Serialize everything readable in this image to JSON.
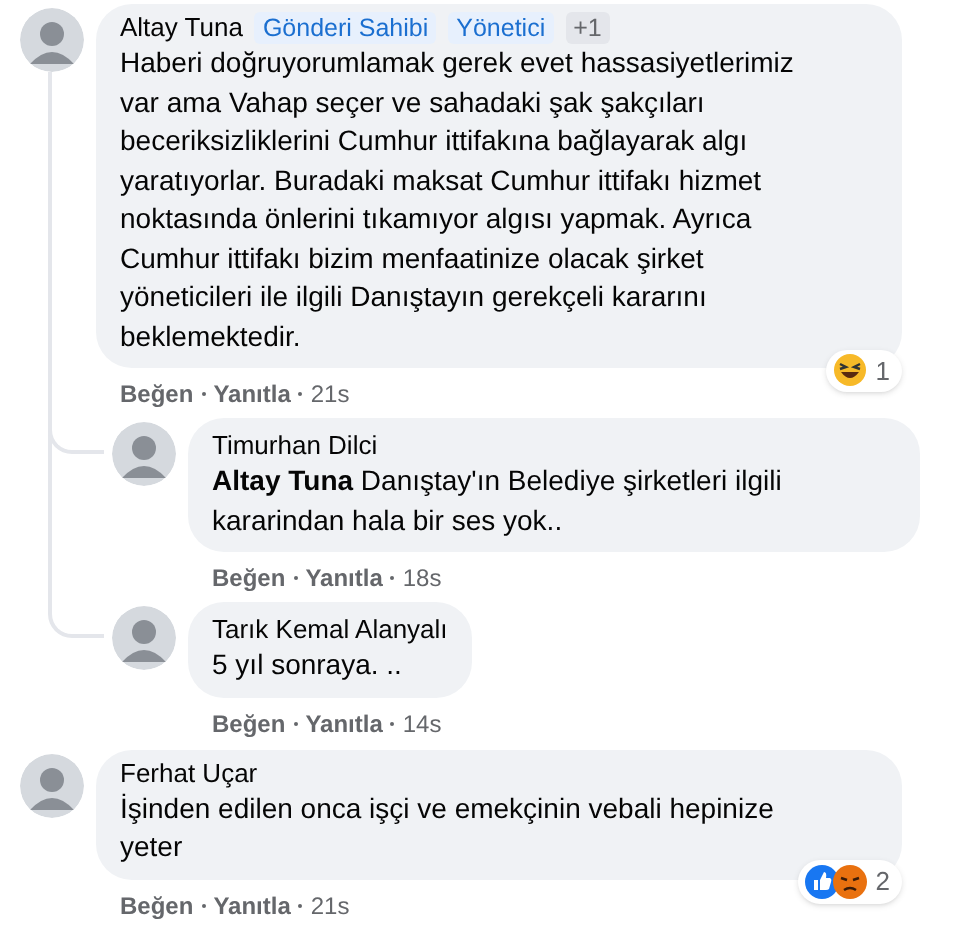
{
  "comments": [
    {
      "author": "Altay Tuna",
      "badges": [
        "Gönderi Sahibi",
        "Yönetici",
        "+1"
      ],
      "text": "Haberi doğruyorumlamak gerek evet hassasiyetlerimiz var ama Vahap seçer ve sahadaki şak şakçıları beceriksizliklerini Cumhur ittifakına bağlayarak algı yaratıyorlar. Buradaki maksat Cumhur ittifakı hizmet noktasında önlerini tıkamıyor algısı yapmak. Ayrıca Cumhur ittifakı bizim menfaatinize olacak şirket yöneticileri ile ilgili Danıştayın gerekçeli kararını beklemektedir.",
      "reactions": [
        {
          "kind": "haha"
        }
      ],
      "reaction_count": "1",
      "actions": [
        "Beğen",
        "Yanıtla",
        "21s"
      ],
      "replies": [
        {
          "author": "Timurhan Dilci",
          "mention": "Altay Tuna",
          "text": "Danıştay'ın Belediye şirketleri ilgili kararindan hala bir ses yok..",
          "actions": [
            "Beğen",
            "Yanıtla",
            "18s"
          ]
        },
        {
          "author": "Tarık Kemal Alanyalı",
          "text": "5 yıl sonraya. ..",
          "actions": [
            "Beğen",
            "Yanıtla",
            "14s"
          ]
        }
      ]
    },
    {
      "author": "Ferhat Uçar",
      "text": "İşinden edilen onca işçi ve emekçinin vebali hepinize yeter",
      "reactions": [
        {
          "kind": "like"
        },
        {
          "kind": "angry"
        }
      ],
      "reaction_count": "2",
      "actions": [
        "Beğen",
        "Yanıtla",
        "21s"
      ]
    }
  ]
}
